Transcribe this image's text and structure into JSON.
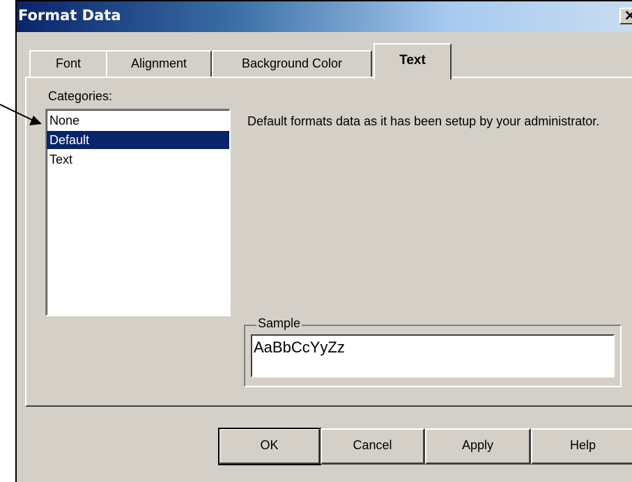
{
  "window": {
    "title": "Format Data",
    "close_label": "×"
  },
  "tabs": [
    {
      "label": "Font",
      "active": false
    },
    {
      "label": "Alignment",
      "active": false
    },
    {
      "label": "Background Color",
      "active": false
    },
    {
      "label": "Text",
      "active": true
    }
  ],
  "categories": {
    "label": "Categories:",
    "items": [
      {
        "label": "None",
        "selected": false
      },
      {
        "label": "Default",
        "selected": true
      },
      {
        "label": "Text",
        "selected": false
      }
    ]
  },
  "description": "Default formats data as it has been setup by your administrator.",
  "sample": {
    "label": "Sample",
    "text": "AaBbCcYyZz"
  },
  "buttons": {
    "ok": "OK",
    "cancel": "Cancel",
    "apply": "Apply",
    "help": "Help"
  },
  "colors": {
    "selection": "#0a246a",
    "face": "#d4d0c8",
    "title_start": "#0a246a"
  },
  "icons": {
    "close": "close-icon",
    "annotation": "arrow-annotation"
  }
}
